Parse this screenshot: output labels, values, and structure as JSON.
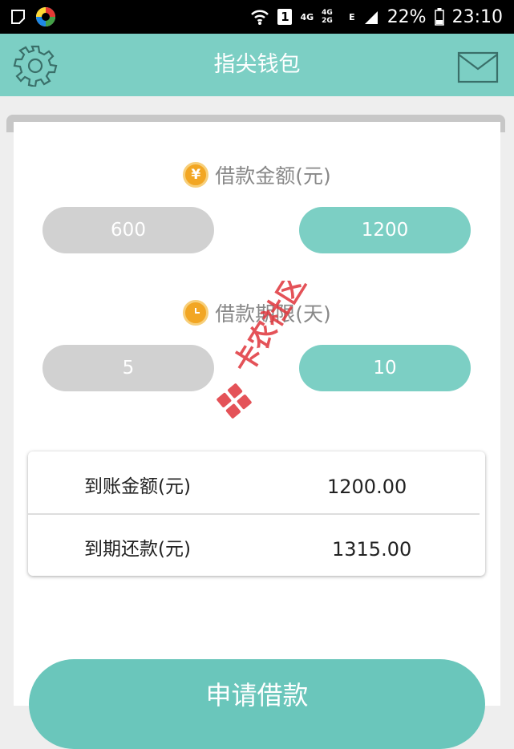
{
  "status_bar": {
    "network_4g": "4G",
    "network_4g2g": "4G 2G",
    "network_e": "E",
    "sim_slot": "1",
    "battery": "22%",
    "time": "23:10"
  },
  "app_bar": {
    "title": "指尖钱包"
  },
  "loan_amount": {
    "label": "借款金额(元)",
    "icon": "yen-icon",
    "options": [
      "600",
      "1200"
    ],
    "selected": "1200"
  },
  "loan_term": {
    "label": "借款期限(天)",
    "icon": "clock-icon",
    "options": [
      "5",
      "10"
    ],
    "selected": "10"
  },
  "summary": {
    "rows": [
      {
        "label": "到账金额(元)",
        "value": "1200.00"
      },
      {
        "label": "到期还款(元)",
        "value": "1315.00"
      }
    ]
  },
  "submit_label": "申请借款",
  "watermark": "卡农社区",
  "colors": {
    "accent": "#7ccfc4",
    "unselected": "#d1d1d1",
    "icon_orange": "#f2a623",
    "watermark_red": "#e0353b"
  }
}
